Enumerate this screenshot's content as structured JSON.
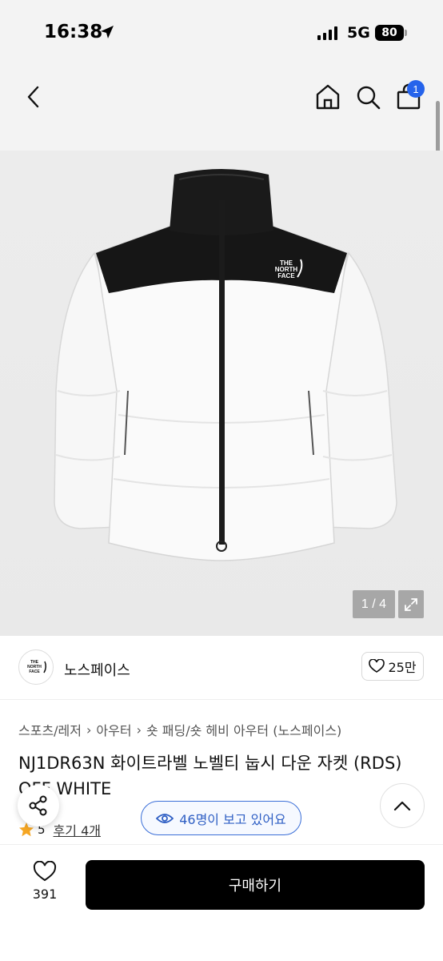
{
  "status_bar": {
    "time": "16:38",
    "network": "5G",
    "battery": "80"
  },
  "nav": {
    "back_icon": "chevron-left-icon",
    "home_icon": "home-icon",
    "search_icon": "search-icon",
    "cart_icon": "shopping-bag-icon",
    "cart_badge": "1"
  },
  "gallery": {
    "counter": "1 / 4",
    "expand_icon": "expand-icon"
  },
  "store": {
    "name": "노스페이스",
    "likes": "25만",
    "logo_text": "THE NORTH FACE"
  },
  "breadcrumb": [
    "스포츠/레저",
    "아우터",
    "숏 패딩/숏 헤비 아우터 (노스페이스)"
  ],
  "product": {
    "title": "NJ1DR63N 화이트라벨 노벨티 눕시 다운 자켓 (RDS) OFF WHITE",
    "rating": "5",
    "reviews": "후기 4개"
  },
  "floating": {
    "viewers": "46명이 보고 있어요",
    "share_icon": "share-icon",
    "scroll_top_icon": "chevron-up-icon"
  },
  "bottom": {
    "wish_count": "391",
    "buy_label": "구매하기"
  },
  "colors": {
    "accent_blue": "#2563eb",
    "viewer_blue": "#2f5fc4",
    "star": "#f5a623",
    "buy_button": "#000000"
  }
}
